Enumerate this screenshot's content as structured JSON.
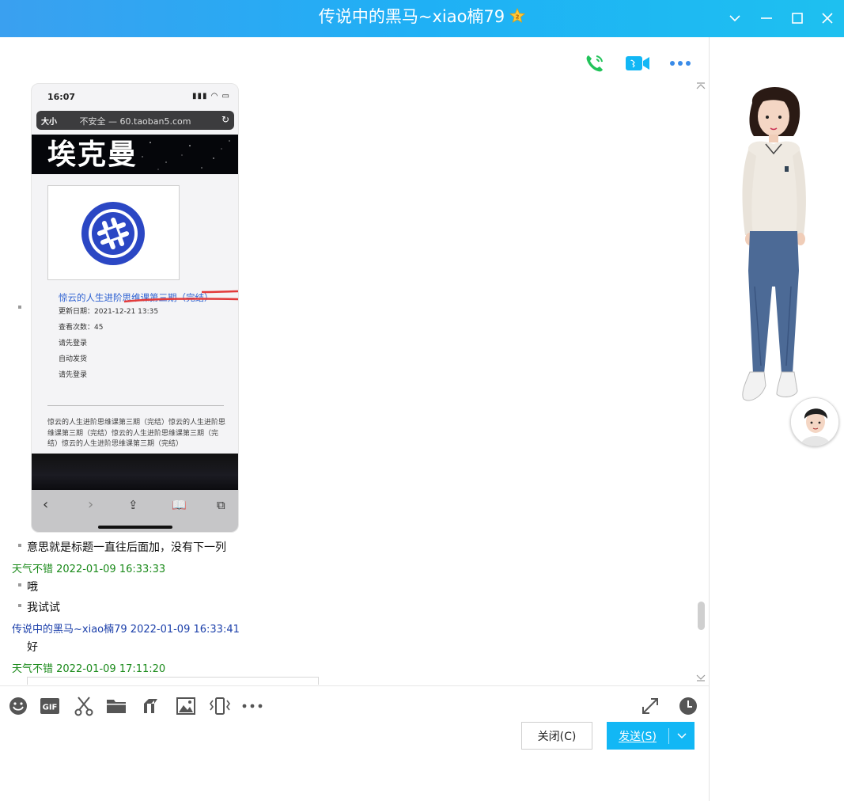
{
  "window": {
    "title": "传说中的黑马~xiao楠79",
    "accent": "#1fb0f5"
  },
  "header_actions": [
    "voice-call-icon",
    "video-call-icon",
    "more-icon"
  ],
  "shared_image": {
    "status_time": "16:07",
    "url_text_size": "大小",
    "url": "不安全 — 60.taoban5.com",
    "brand": "埃克曼",
    "product_title": "惊云的人生进阶思维课第三期（完结）",
    "meta": [
      "更新日期：2021-12-21 13:35",
      "查看次数：45",
      "请先登录",
      "自动发货",
      "请先登录"
    ],
    "description": "惊云的人生进阶思维课第三期（完结）惊云的人生进阶思维课第三期（完结）惊云的人生进阶思维课第三期（完结）惊云的人生进阶思维课第三期（完结）"
  },
  "messages": [
    {
      "type": "text",
      "text": "意思就是标题一直往后面加，没有下一列"
    },
    {
      "type": "meta",
      "sender": "天气不错",
      "time": "2022-01-09 16:33:33"
    },
    {
      "type": "text",
      "text": "哦"
    },
    {
      "type": "text",
      "text": "我试试"
    },
    {
      "type": "meta",
      "sender": "传说中的黑马~xiao楠79",
      "time": "2022-01-09 16:33:41"
    },
    {
      "type": "text",
      "text": "好"
    },
    {
      "type": "meta",
      "sender": "天气不错",
      "time": "2022-01-09 17:11:20"
    }
  ],
  "meta_lines": {
    "m1": "天气不错 2022-01-09 16:33:33",
    "m2": "传说中的黑马~xiao楠79 2022-01-09 16:33:41",
    "m3": "天气不错 2022-01-09 17:11:20"
  },
  "toolbar": {
    "icons": [
      "emoji-icon",
      "gif-icon",
      "screenshot-icon",
      "folder-icon",
      "music-icon",
      "image-icon",
      "shake-icon",
      "more-icon",
      "expand-icon",
      "history-icon"
    ]
  },
  "buttons": {
    "close": "关闭(C)",
    "send": "发送(S)"
  }
}
